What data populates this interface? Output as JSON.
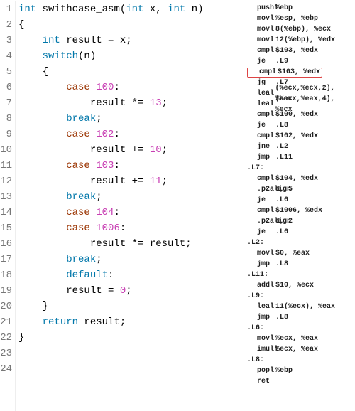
{
  "code": {
    "lines": [
      {
        "n": "1",
        "tokens": [
          {
            "t": "int",
            "c": "tok-type"
          },
          {
            "t": " "
          },
          {
            "t": "swithcase_asm",
            "c": "tok-func"
          },
          {
            "t": "("
          },
          {
            "t": "int",
            "c": "tok-type"
          },
          {
            "t": " x, "
          },
          {
            "t": "int",
            "c": "tok-type"
          },
          {
            "t": " n)"
          }
        ]
      },
      {
        "n": "2",
        "tokens": [
          {
            "t": "{"
          }
        ]
      },
      {
        "n": "3",
        "tokens": [
          {
            "t": "    "
          },
          {
            "t": "int",
            "c": "tok-type"
          },
          {
            "t": " result = x;"
          }
        ]
      },
      {
        "n": "4",
        "tokens": [
          {
            "t": ""
          }
        ]
      },
      {
        "n": "5",
        "tokens": [
          {
            "t": "    "
          },
          {
            "t": "switch",
            "c": "tok-kw"
          },
          {
            "t": "(n)"
          }
        ]
      },
      {
        "n": "6",
        "tokens": [
          {
            "t": "    {"
          }
        ]
      },
      {
        "n": "7",
        "tokens": [
          {
            "t": "        "
          },
          {
            "t": "case",
            "c": "tok-case"
          },
          {
            "t": " "
          },
          {
            "t": "100",
            "c": "tok-num"
          },
          {
            "t": ":"
          }
        ]
      },
      {
        "n": "8",
        "tokens": [
          {
            "t": "            result *= "
          },
          {
            "t": "13",
            "c": "tok-num"
          },
          {
            "t": ";"
          }
        ]
      },
      {
        "n": "9",
        "tokens": [
          {
            "t": "        "
          },
          {
            "t": "break",
            "c": "tok-kw"
          },
          {
            "t": ";"
          }
        ]
      },
      {
        "n": "10",
        "tokens": [
          {
            "t": "        "
          },
          {
            "t": "case",
            "c": "tok-case"
          },
          {
            "t": " "
          },
          {
            "t": "102",
            "c": "tok-num"
          },
          {
            "t": ":"
          }
        ]
      },
      {
        "n": "11",
        "tokens": [
          {
            "t": "            result += "
          },
          {
            "t": "10",
            "c": "tok-num"
          },
          {
            "t": ";"
          }
        ]
      },
      {
        "n": "12",
        "tokens": [
          {
            "t": "        "
          },
          {
            "t": "case",
            "c": "tok-case"
          },
          {
            "t": " "
          },
          {
            "t": "103",
            "c": "tok-num"
          },
          {
            "t": ":"
          }
        ]
      },
      {
        "n": "13",
        "tokens": [
          {
            "t": "            result += "
          },
          {
            "t": "11",
            "c": "tok-num"
          },
          {
            "t": ";"
          }
        ]
      },
      {
        "n": "14",
        "tokens": [
          {
            "t": "        "
          },
          {
            "t": "break",
            "c": "tok-kw"
          },
          {
            "t": ";"
          }
        ]
      },
      {
        "n": "15",
        "tokens": [
          {
            "t": "        "
          },
          {
            "t": "case",
            "c": "tok-case"
          },
          {
            "t": " "
          },
          {
            "t": "104",
            "c": "tok-num"
          },
          {
            "t": ":"
          }
        ]
      },
      {
        "n": "16",
        "tokens": [
          {
            "t": "        "
          },
          {
            "t": "case",
            "c": "tok-case"
          },
          {
            "t": " "
          },
          {
            "t": "1006",
            "c": "tok-num"
          },
          {
            "t": ":"
          }
        ]
      },
      {
        "n": "17",
        "tokens": [
          {
            "t": "            result *= result;"
          }
        ]
      },
      {
        "n": "18",
        "tokens": [
          {
            "t": "        "
          },
          {
            "t": "break",
            "c": "tok-kw"
          },
          {
            "t": ";"
          }
        ]
      },
      {
        "n": "19",
        "tokens": [
          {
            "t": "        "
          },
          {
            "t": "default",
            "c": "tok-kw"
          },
          {
            "t": ":"
          }
        ]
      },
      {
        "n": "20",
        "tokens": [
          {
            "t": "        result = "
          },
          {
            "t": "0",
            "c": "tok-num"
          },
          {
            "t": ";"
          }
        ]
      },
      {
        "n": "21",
        "tokens": [
          {
            "t": "    }"
          }
        ]
      },
      {
        "n": "22",
        "tokens": [
          {
            "t": ""
          }
        ]
      },
      {
        "n": "23",
        "tokens": [
          {
            "t": "    "
          },
          {
            "t": "return",
            "c": "tok-kw"
          },
          {
            "t": " result;"
          }
        ]
      },
      {
        "n": "24",
        "tokens": [
          {
            "t": "}"
          }
        ]
      }
    ]
  },
  "asm": {
    "lines": [
      {
        "kind": "ins",
        "mnem": "pushl",
        "args": "%ebp"
      },
      {
        "kind": "ins",
        "mnem": "movl",
        "args": "%esp, %ebp"
      },
      {
        "kind": "ins",
        "mnem": "movl",
        "args": "8(%ebp), %ecx"
      },
      {
        "kind": "ins",
        "mnem": "movl",
        "args": "12(%ebp), %edx"
      },
      {
        "kind": "ins",
        "mnem": "cmpl",
        "args": "$103, %edx"
      },
      {
        "kind": "ins",
        "mnem": "je",
        "args": ".L9"
      },
      {
        "kind": "ins",
        "mnem": "cmpl",
        "args": "$103, %edx",
        "highlight": true
      },
      {
        "kind": "ins",
        "mnem": "jg",
        "args": ".L7"
      },
      {
        "kind": "ins",
        "mnem": "leal",
        "args": "(%ecx,%ecx,2), %eax"
      },
      {
        "kind": "ins",
        "mnem": "leal",
        "args": "(%ecx,%eax,4), %ecx"
      },
      {
        "kind": "ins",
        "mnem": "cmpl",
        "args": "$100, %edx"
      },
      {
        "kind": "ins",
        "mnem": "je",
        "args": ".L8"
      },
      {
        "kind": "ins",
        "mnem": "cmpl",
        "args": "$102, %edx"
      },
      {
        "kind": "ins",
        "mnem": "jne",
        "args": ".L2"
      },
      {
        "kind": "ins",
        "mnem": "jmp",
        "args": ".L11"
      },
      {
        "kind": "label",
        "text": ".L7:"
      },
      {
        "kind": "ins",
        "mnem": "cmpl",
        "args": "$104, %edx"
      },
      {
        "kind": "ins",
        "mnem": ".p2align",
        "args": "4,,5"
      },
      {
        "kind": "ins",
        "mnem": "je",
        "args": ".L6"
      },
      {
        "kind": "ins",
        "mnem": "cmpl",
        "args": "$1006, %edx"
      },
      {
        "kind": "ins",
        "mnem": ".p2align",
        "args": "4,,2"
      },
      {
        "kind": "ins",
        "mnem": "je",
        "args": ".L6"
      },
      {
        "kind": "label",
        "text": ".L2:"
      },
      {
        "kind": "ins",
        "mnem": "movl",
        "args": "$0, %eax"
      },
      {
        "kind": "ins",
        "mnem": "jmp",
        "args": ".L8"
      },
      {
        "kind": "label",
        "text": ".L11:"
      },
      {
        "kind": "ins",
        "mnem": "addl",
        "args": "$10, %ecx"
      },
      {
        "kind": "label",
        "text": ".L9:"
      },
      {
        "kind": "ins",
        "mnem": "leal",
        "args": "11(%ecx), %eax"
      },
      {
        "kind": "ins",
        "mnem": "jmp",
        "args": ".L8"
      },
      {
        "kind": "label",
        "text": ".L6:"
      },
      {
        "kind": "ins",
        "mnem": "movl",
        "args": "%ecx, %eax"
      },
      {
        "kind": "ins",
        "mnem": "imull",
        "args": "%ecx, %eax"
      },
      {
        "kind": "label",
        "text": ".L8:"
      },
      {
        "kind": "ins",
        "mnem": "popl",
        "args": "%ebp"
      },
      {
        "kind": "ins",
        "mnem": "ret",
        "args": ""
      }
    ]
  }
}
